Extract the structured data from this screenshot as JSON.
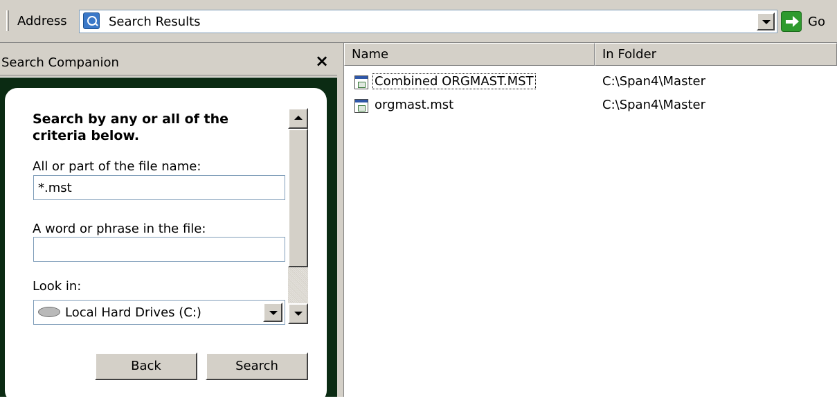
{
  "address_bar": {
    "label": "Address",
    "value": "Search Results",
    "icon": "search-results-icon",
    "go_label": "Go"
  },
  "companion": {
    "title": "Search Companion",
    "close_glyph": "×",
    "heading": "Search by any or all of the criteria below.",
    "file_name_label": "All or part of the file name:",
    "file_name_value": "*.mst",
    "phrase_label": "A word or phrase in the file:",
    "phrase_value": "",
    "look_in_label": "Look in:",
    "look_in_value": "Local Hard Drives (C:)",
    "back_label": "Back",
    "search_label": "Search"
  },
  "results": {
    "columns": [
      "Name",
      "In Folder"
    ],
    "rows": [
      {
        "name": "Combined ORGMAST.MST",
        "folder": "C:\\Span4\\Master",
        "focused": true
      },
      {
        "name": "orgmast.mst",
        "folder": "C:\\Span4\\Master",
        "focused": false
      }
    ]
  },
  "colors": {
    "chrome": "#d4d0c8",
    "companion_panel": "#0b2b13",
    "go_green": "#2e9a2e"
  }
}
